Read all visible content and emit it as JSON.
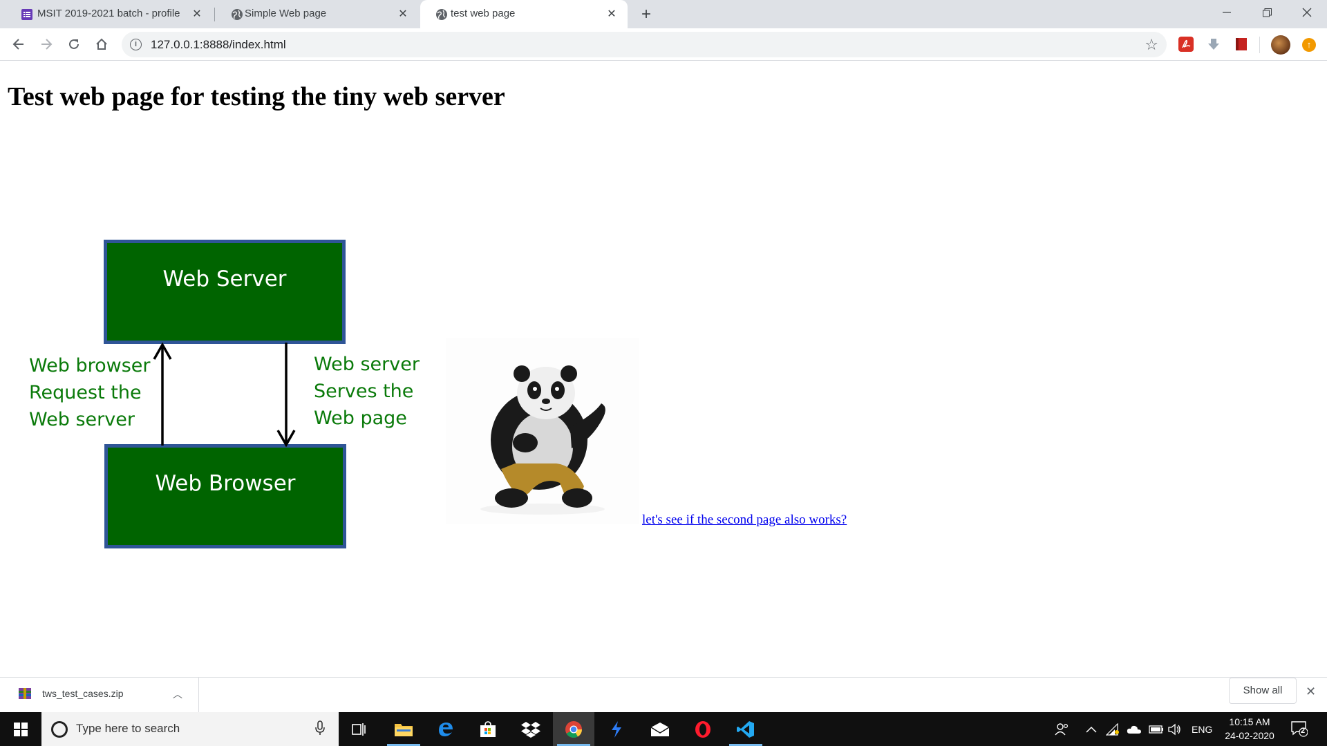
{
  "browser": {
    "tabs": [
      {
        "title": "MSIT 2019-2021 batch - profile",
        "icon": "google-forms-icon",
        "active": false
      },
      {
        "title": "Simple Web page",
        "icon": "globe-icon",
        "active": false
      },
      {
        "title": "test web page",
        "icon": "globe-icon",
        "active": true
      }
    ],
    "url": "127.0.0.1:8888/index.html"
  },
  "page": {
    "heading": "Test web page for testing the tiny web server",
    "diagram": {
      "server_box": "Web Server",
      "browser_box": "Web Browser",
      "left_label": [
        "Web browser",
        "Request the",
        "Web server"
      ],
      "right_label": [
        "Web server",
        "Serves the",
        "Web page"
      ]
    },
    "image_alt": "panda-image",
    "link_text": "let's see if the second page also works?"
  },
  "downloads": {
    "file_name": "tws_test_cases.zip",
    "show_all": "Show all"
  },
  "taskbar": {
    "search_placeholder": "Type here to search",
    "language": "ENG",
    "time": "10:15 AM",
    "date": "24-02-2020",
    "notification_count": "2"
  },
  "colors": {
    "diagram_green": "#006400",
    "diagram_border": "#2f5597",
    "label_green": "#0a7a0a",
    "link": "#0000ee"
  }
}
